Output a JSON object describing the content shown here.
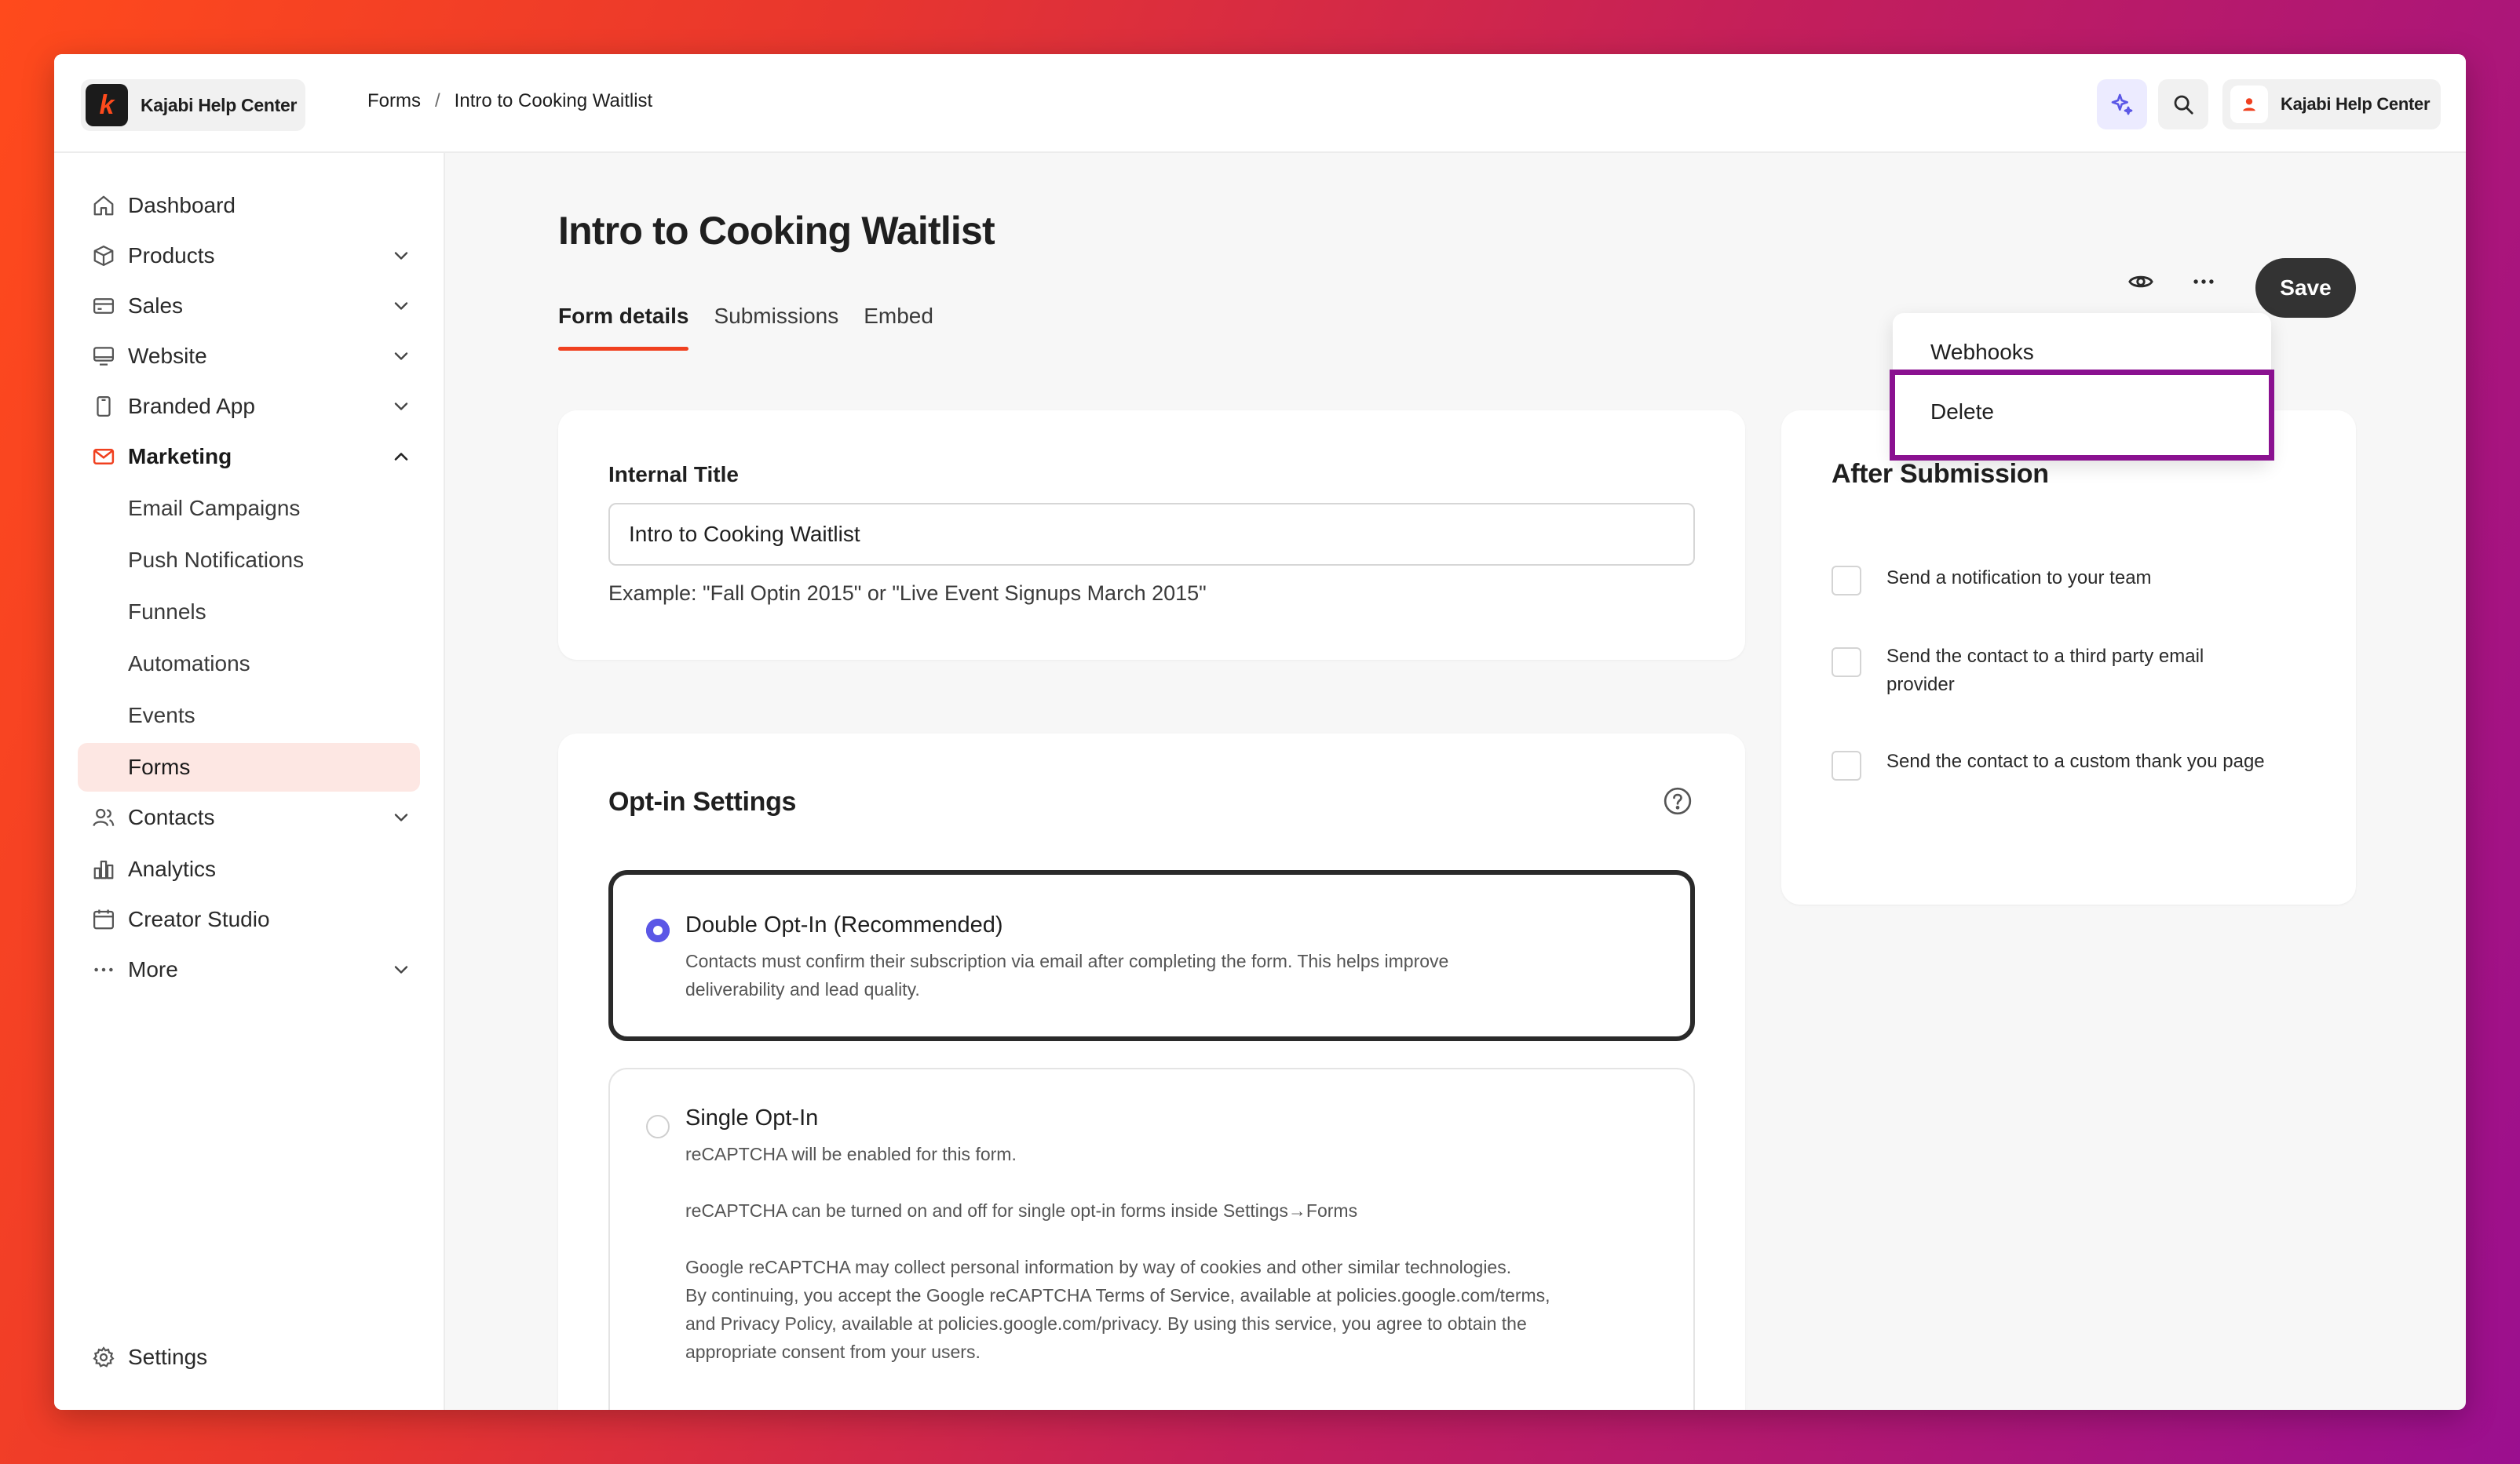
{
  "topbar": {
    "brand_name": "Kajabi Help Center",
    "brand_logo_letter": "k",
    "breadcrumb": {
      "parent": "Forms",
      "separator": "/",
      "current": "Intro to Cooking Waitlist"
    },
    "account_name": "Kajabi Help Center"
  },
  "sidebar": {
    "items": [
      {
        "label": "Dashboard",
        "icon": "home-icon"
      },
      {
        "label": "Products",
        "icon": "box-icon"
      },
      {
        "label": "Sales",
        "icon": "credit-card-icon"
      },
      {
        "label": "Website",
        "icon": "monitor-icon"
      },
      {
        "label": "Branded App",
        "icon": "phone-icon"
      },
      {
        "label": "Marketing",
        "icon": "mail-icon"
      },
      {
        "label": "Contacts",
        "icon": "users-icon"
      },
      {
        "label": "Analytics",
        "icon": "bar-chart-icon"
      },
      {
        "label": "Creator Studio",
        "icon": "calendar-icon"
      },
      {
        "label": "More",
        "icon": "dots-icon"
      }
    ],
    "marketing_sub": [
      "Email Campaigns",
      "Push Notifications",
      "Funnels",
      "Automations",
      "Events",
      "Forms"
    ],
    "settings_label": "Settings"
  },
  "main": {
    "title": "Intro to Cooking Waitlist",
    "tabs": [
      "Form details",
      "Submissions",
      "Embed"
    ],
    "save_label": "Save",
    "more_menu": [
      "Webhooks",
      "Delete"
    ],
    "internal_title": {
      "label": "Internal Title",
      "value": "Intro to Cooking Waitlist",
      "hint": "Example: \"Fall Optin 2015\" or \"Live Event Signups March 2015\""
    },
    "optin": {
      "title": "Opt-in Settings",
      "double": {
        "title": "Double Opt-In (Recommended)",
        "desc_1": "Contacts must confirm their subscription via email after completing the form. This helps improve",
        "desc_2": "deliverability and lead quality."
      },
      "single": {
        "title": "Single Opt-In",
        "line_1": "reCAPTCHA will be enabled for this form.",
        "line_2": "reCAPTCHA can be turned on and off for single opt-in forms inside Settings→Forms",
        "line_3": "Google reCAPTCHA may collect personal information by way of cookies and other similar technologies.",
        "line_4": "By continuing, you accept the Google reCAPTCHA Terms of Service, available at policies.google.com/terms,",
        "line_5": "and Privacy Policy, available at policies.google.com/privacy. By using this service, you agree to obtain the",
        "line_6": "appropriate consent from your users."
      }
    },
    "after_submission": {
      "title": "After Submission",
      "opt_1": "Send a notification to your team",
      "opt_2_a": "Send the contact to a third party email",
      "opt_2_b": "provider",
      "opt_3": "Send the contact to a custom thank you page"
    }
  },
  "colors": {
    "accent": "#f0401f",
    "radio": "#5b57e6",
    "highlight": "#8a1190",
    "selected_nav_bg": "#fde7e3"
  }
}
